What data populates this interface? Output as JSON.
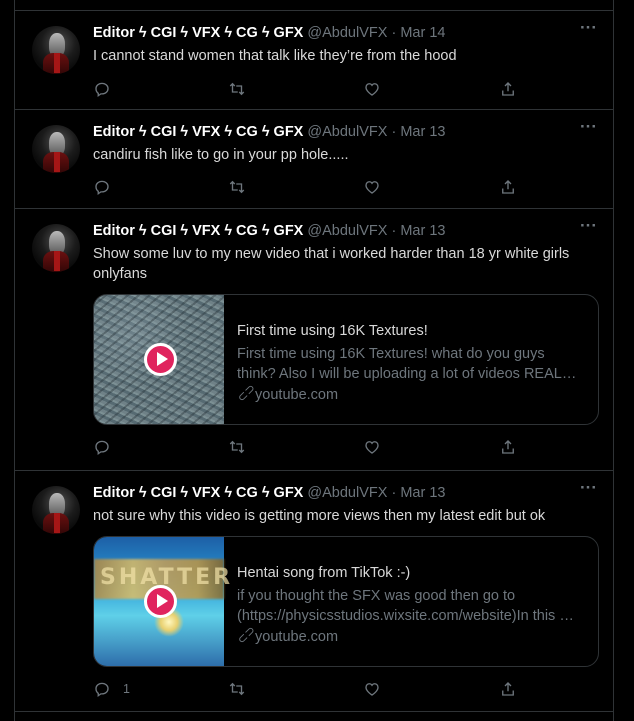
{
  "tweets": [
    {
      "name": "Editor ϟ CGI ϟ VFX ϟ CG ϟ GFX",
      "handle": "@AbdulVFX",
      "separator": "·",
      "date": "Mar 14",
      "text": "I cannot stand women that talk like they’re from the hood",
      "more": "···",
      "reply_count": ""
    },
    {
      "name": "Editor ϟ CGI ϟ VFX ϟ CG ϟ GFX",
      "handle": "@AbdulVFX",
      "separator": "·",
      "date": "Mar 13",
      "text": "candiru fish like to go in your pp hole.....",
      "more": "···",
      "reply_count": ""
    },
    {
      "name": "Editor ϟ CGI ϟ VFX ϟ CG ϟ GFX",
      "handle": "@AbdulVFX",
      "separator": "·",
      "date": "Mar 13",
      "text": "Show some luv to my new video that i worked harder than  18 yr white girls onlyfans",
      "more": "···",
      "card": {
        "title": "First time using 16K Textures!",
        "description": "First time using 16K Textures! what do you guys think? Also I will be uploading a lot of videos REAL…",
        "link": "youtube.com"
      },
      "reply_count": ""
    },
    {
      "name": "Editor ϟ CGI ϟ VFX ϟ CG ϟ GFX",
      "handle": "@AbdulVFX",
      "separator": "·",
      "date": "Mar 13",
      "text": "not sure why this video is getting more views then my latest edit but ok",
      "more": "···",
      "card": {
        "title": "Hentai song from TikTok :-)",
        "description": "if you thought the SFX was good then go to (https://physicsstudios.wixsite.com/website)In this …",
        "link": "youtube.com",
        "thumb_text": "SHATTER"
      },
      "reply_count": "1"
    }
  ],
  "icons": {
    "reply": "reply-icon",
    "retweet": "retweet-icon",
    "like": "like-icon",
    "share": "share-icon",
    "more": "more-icon",
    "play": "play-icon",
    "link": "link-icon"
  },
  "colors": {
    "background": "#000000",
    "text": "#d9d9d9",
    "secondary": "#6e767d",
    "border": "#2f3336",
    "play_button": "#e0245e"
  }
}
